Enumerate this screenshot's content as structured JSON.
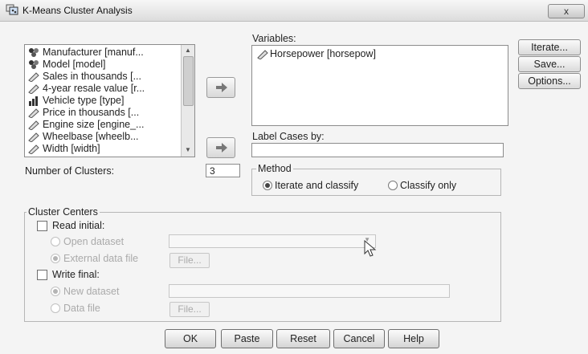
{
  "window": {
    "title": "K-Means Cluster Analysis",
    "close_label": "x"
  },
  "source_list": {
    "items": [
      {
        "label": "Manufacturer [manuf...",
        "icon": "nominal-icon"
      },
      {
        "label": "Model [model]",
        "icon": "nominal-icon"
      },
      {
        "label": "Sales in thousands [...",
        "icon": "scale-ruler-icon"
      },
      {
        "label": "4-year resale value [r...",
        "icon": "scale-ruler-icon"
      },
      {
        "label": "Vehicle type [type]",
        "icon": "ordinal-bars-icon"
      },
      {
        "label": "Price in thousands [...",
        "icon": "scale-ruler-icon"
      },
      {
        "label": "Engine size [engine_...",
        "icon": "scale-ruler-icon"
      },
      {
        "label": "Wheelbase [wheelb...",
        "icon": "scale-ruler-icon"
      },
      {
        "label": "Width [width]",
        "icon": "scale-ruler-icon"
      }
    ]
  },
  "variables": {
    "label": "Variables:",
    "items": [
      {
        "label": "Horsepower [horsepow]",
        "icon": "scale-ruler-icon"
      }
    ]
  },
  "label_cases": {
    "label": "Label Cases by:",
    "value": ""
  },
  "side_buttons": {
    "iterate": "Iterate...",
    "save": "Save...",
    "options": "Options..."
  },
  "clusters": {
    "label": "Number of Clusters:",
    "value": "3"
  },
  "method": {
    "legend": "Method",
    "options": [
      {
        "label": "Iterate and classify",
        "selected": true
      },
      {
        "label": "Classify only",
        "selected": false
      }
    ]
  },
  "cluster_centers": {
    "legend": "Cluster Centers",
    "read_initial": {
      "label": "Read initial:",
      "checked": false
    },
    "open_dataset": "Open dataset",
    "external_data_file": "External data file",
    "file_button": "File...",
    "write_final": {
      "label": "Write final:",
      "checked": false
    },
    "new_dataset": "New dataset",
    "data_file": "Data file",
    "file_button2": "File..."
  },
  "footer": {
    "ok": "OK",
    "paste": "Paste",
    "reset": "Reset",
    "cancel": "Cancel",
    "help": "Help"
  }
}
